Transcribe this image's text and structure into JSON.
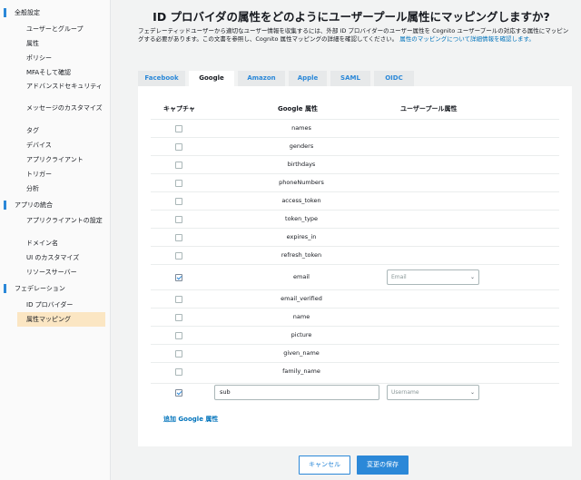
{
  "sidebar": {
    "sections": [
      {
        "label": "全般設定",
        "items": [
          "ユーザーとグループ",
          "属性",
          "ポリシー",
          "MFAそして確認",
          "アドバンスドセキュリティ",
          "メッセージのカスタマイズ",
          "タグ",
          "デバイス",
          "アプリクライアント",
          "トリガー",
          "分析"
        ]
      },
      {
        "label": "アプリの統合",
        "items": [
          "アプリクライアントの設定",
          "ドメイン名",
          "UI のカスタマイズ",
          "リソースサーバー"
        ]
      },
      {
        "label": "フェデレーション",
        "items": [
          "ID プロバイダー",
          "属性マッピング"
        ]
      }
    ]
  },
  "header": {
    "title": "ID プロバイダの属性をどのようにユーザープール属性にマッピングしますか?",
    "description": "フェデレーティッドユーザーから適切なユーザー情報を収集するには、外部 ID プロバイダーのユーザー属性を Cognito ユーザープールの対応する属性にマッピングする必要があります。この文書を参照し、Cognito 属性マッピングの詳細を確認してください。",
    "link": "属性のマッピングについて詳細情報を確認します。"
  },
  "tabs": [
    "Facebook",
    "Google",
    "Amazon",
    "Apple",
    "SAML",
    "OIDC"
  ],
  "active_tab": "Google",
  "table": {
    "headers": {
      "capture": "キャプチャ",
      "google_attr": "Google 属性",
      "pool_attr": "ユーザープール属性"
    },
    "rows": [
      {
        "attr": "names",
        "checked": false
      },
      {
        "attr": "genders",
        "checked": false
      },
      {
        "attr": "birthdays",
        "checked": false
      },
      {
        "attr": "phoneNumbers",
        "checked": false
      },
      {
        "attr": "access_token",
        "checked": false
      },
      {
        "attr": "token_type",
        "checked": false
      },
      {
        "attr": "expires_in",
        "checked": false
      },
      {
        "attr": "refresh_token",
        "checked": false
      },
      {
        "attr": "email",
        "checked": true,
        "mapping": "Email"
      },
      {
        "attr": "email_verified",
        "checked": false
      },
      {
        "attr": "name",
        "checked": false
      },
      {
        "attr": "picture",
        "checked": false
      },
      {
        "attr": "given_name",
        "checked": false
      },
      {
        "attr": "family_name",
        "checked": false
      }
    ],
    "custom_row": {
      "value": "sub",
      "checked": true,
      "mapping": "Username"
    }
  },
  "add_link": "追加 Google 属性",
  "buttons": {
    "cancel": "キャンセル",
    "save": "変更の保存"
  }
}
